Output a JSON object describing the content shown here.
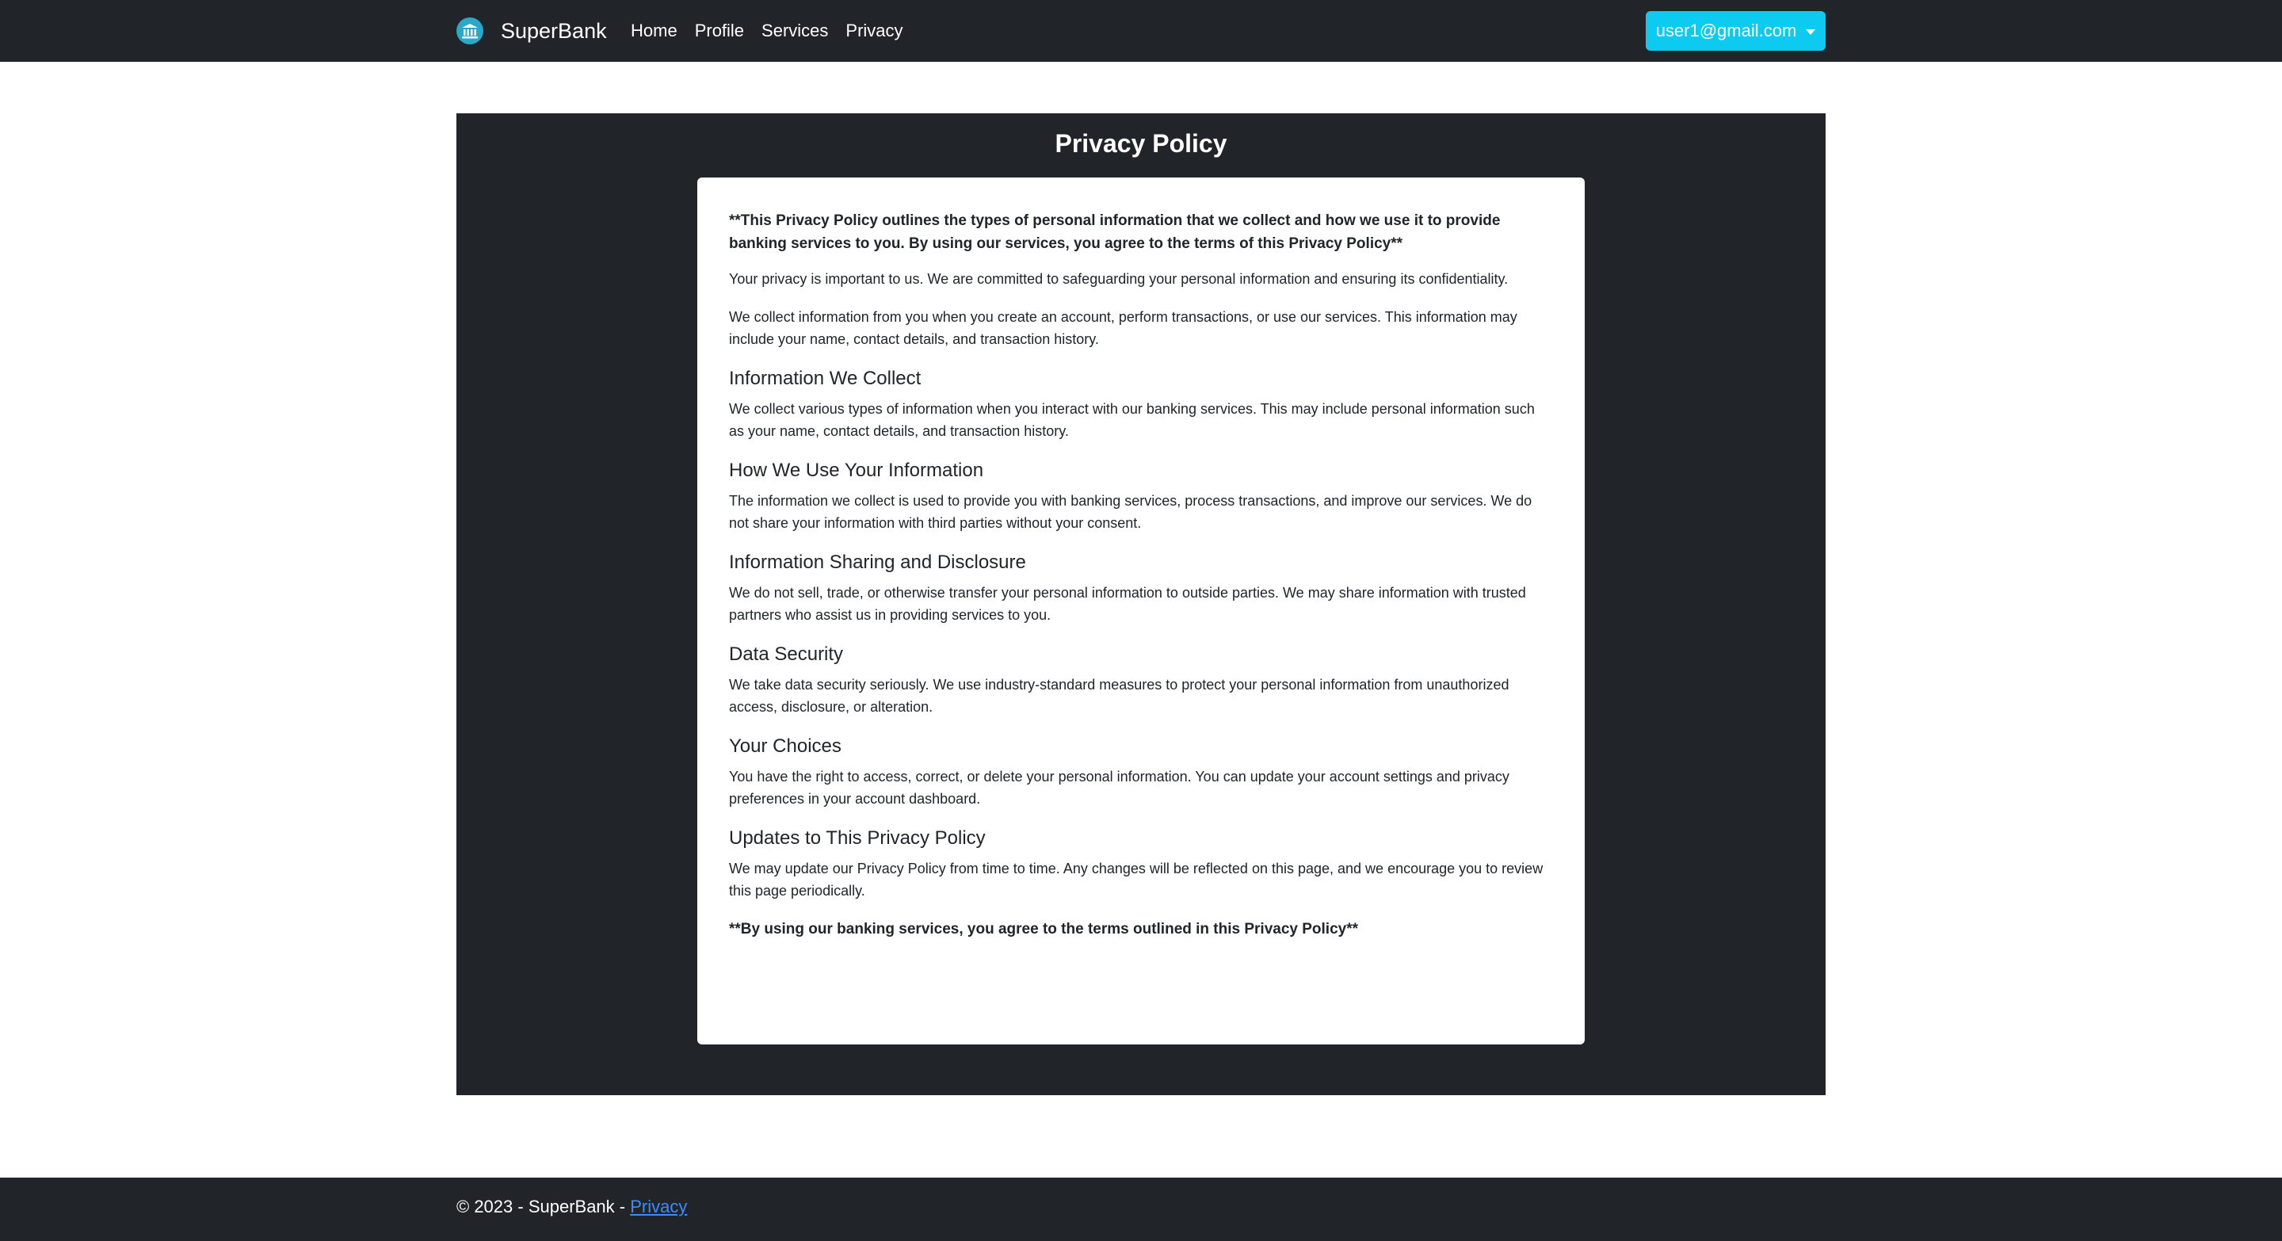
{
  "navbar": {
    "brand_text": "SuperBank",
    "brand_icon": "bank-icon",
    "links": [
      "Home",
      "Profile",
      "Services",
      "Privacy"
    ],
    "user_email": "user1@gmail.com"
  },
  "main": {
    "title": "Privacy Policy",
    "intro_bold": "**This Privacy Policy outlines the types of personal information that we collect and how we use it to provide banking services to you. By using our services, you agree to the terms of this Privacy Policy**",
    "intro_paragraphs": [
      "Your privacy is important to us. We are committed to safeguarding your personal information and ensuring its confidentiality.",
      "We collect information from you when you create an account, perform transactions, or use our services. This information may include your name, contact details, and transaction history."
    ],
    "sections": [
      {
        "heading": "Information We Collect",
        "text": "We collect various types of information when you interact with our banking services. This may include personal information such as your name, contact details, and transaction history."
      },
      {
        "heading": "How We Use Your Information",
        "text": "The information we collect is used to provide you with banking services, process transactions, and improve our services. We do not share your information with third parties without your consent."
      },
      {
        "heading": "Information Sharing and Disclosure",
        "text": "We do not sell, trade, or otherwise transfer your personal information to outside parties. We may share information with trusted partners who assist us in providing services to you."
      },
      {
        "heading": "Data Security",
        "text": "We take data security seriously. We use industry-standard measures to protect your personal information from unauthorized access, disclosure, or alteration."
      },
      {
        "heading": "Your Choices",
        "text": "You have the right to access, correct, or delete your personal information. You can update your account settings and privacy preferences in your account dashboard."
      },
      {
        "heading": "Updates to This Privacy Policy",
        "text": "We may update our Privacy Policy from time to time. Any changes will be reflected on this page, and we encourage you to review this page periodically."
      }
    ],
    "outro_bold": "**By using our banking services, you agree to the terms outlined in this Privacy Policy**"
  },
  "footer": {
    "text": "© 2023 - SuperBank - ",
    "link": "Privacy"
  },
  "colors": {
    "dark": "#212529",
    "accent": "#0dcaf0",
    "link": "#3d8bfd"
  }
}
